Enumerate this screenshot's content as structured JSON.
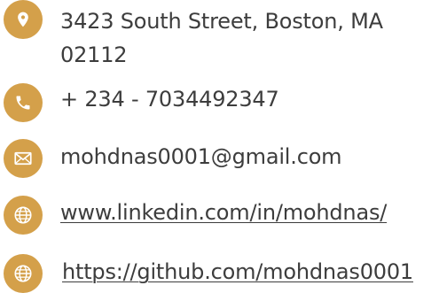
{
  "accent_color": "#d4a04a",
  "contact": {
    "address": {
      "icon": "location-pin-icon",
      "line1": "3423 South Street, Boston, MA",
      "line2": "02112"
    },
    "phone": {
      "icon": "phone-icon",
      "text": "+ 234 - 7034492347"
    },
    "email": {
      "icon": "envelope-icon",
      "text": "mohdnas0001@gmail.com"
    },
    "linkedin": {
      "icon": "globe-icon",
      "text": "www.linkedin.com/in/mohdnas/"
    },
    "github": {
      "icon": "globe-icon",
      "text": "https://github.com/mohdnas0001"
    }
  }
}
